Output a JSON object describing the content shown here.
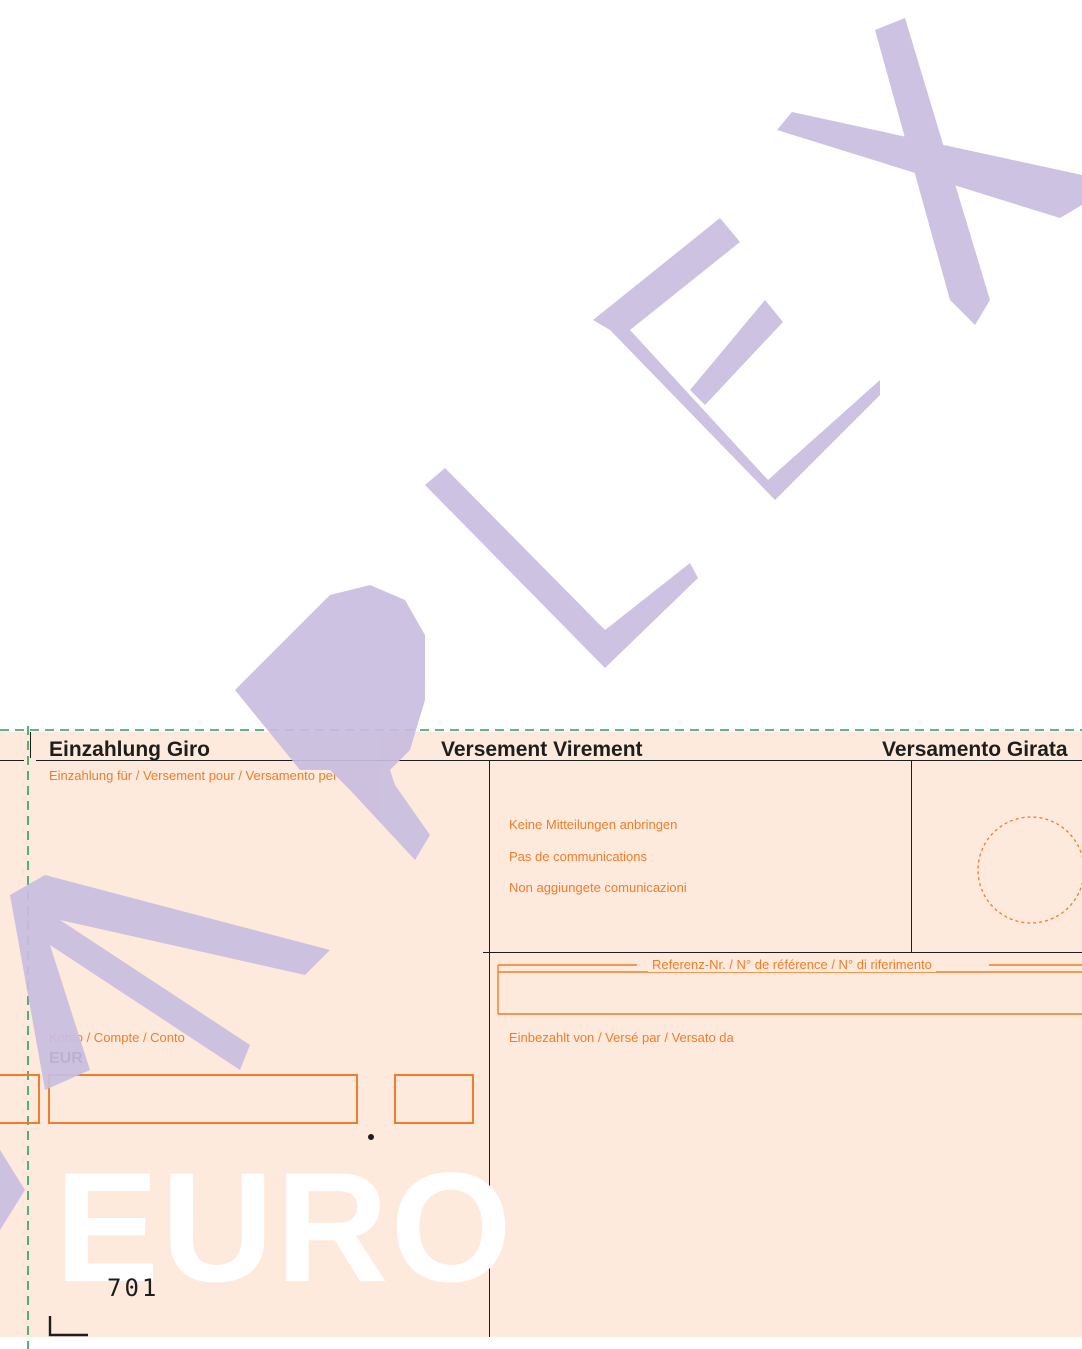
{
  "watermark": {
    "text": "SAMPLEX",
    "color": "#c9bde0"
  },
  "slip": {
    "background": "#fdeadc",
    "accent": "#ef7d2b",
    "titles": {
      "de": "Einzahlung Giro",
      "fr": "Versement Virement",
      "it": "Versamento Girata"
    },
    "payee_label": "Einzahlung für / Versement pour / Versamento per",
    "notice": [
      "Keine Mitteilungen anbringen",
      "Pas de communications",
      "Non aggiungete comunicazioni"
    ],
    "reference_label": "Referenz-Nr. / N° de référence / N° di riferimento",
    "payer_label": "Einbezahlt von / Versé par / Versato da",
    "account_label": "Konto / Compte / Conto",
    "currency": "EUR",
    "euro_emblem": "EURO",
    "code": "701"
  }
}
